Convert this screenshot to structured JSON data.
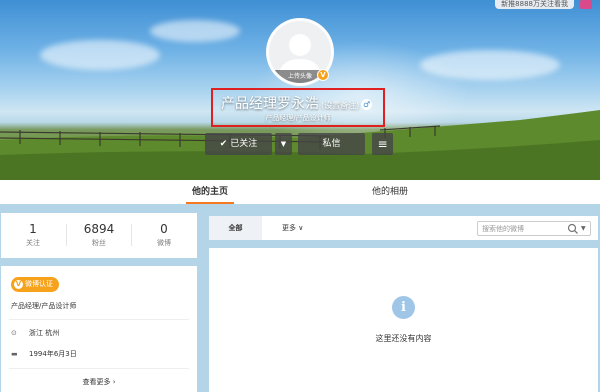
{
  "cover": {
    "top_notice": "新推8888万关注看我",
    "avatar_upload_label": "上传头像",
    "verify_badge": "V"
  },
  "user": {
    "name": "产品经理罗永浩",
    "remark_label": "(设置备注)",
    "gender_symbol": "♂",
    "description": "产品经理/产品设计师"
  },
  "actions": {
    "follow_label": "已关注",
    "follow_check": "✔",
    "dropdown_symbol": "▼",
    "message_label": "私信",
    "menu_symbol": "≡"
  },
  "tabs": [
    {
      "label": "他的主页",
      "active": true
    },
    {
      "label": "他的相册",
      "active": false
    }
  ],
  "stats": [
    {
      "value": "1",
      "label": "关注"
    },
    {
      "value": "6894",
      "label": "粉丝"
    },
    {
      "value": "0",
      "label": "微博"
    }
  ],
  "profile": {
    "badge_label": "微博认证",
    "badge_v": "V",
    "title": "产品经理/产品设计师",
    "location": "浙江 杭州",
    "birthday": "1994年6月3日",
    "see_more": "查看更多 ›"
  },
  "feed": {
    "tab_all": "全部",
    "tab_more": "更多 ∨",
    "search_placeholder": "搜索他的微博",
    "search_caret": "▼",
    "empty_icon": "i",
    "empty_text": "这里还没有内容"
  },
  "colors": {
    "accent": "#f47920",
    "verify": "#f7a21b",
    "highlight_box": "#e02020",
    "page_bg": "#b4d4e8"
  }
}
